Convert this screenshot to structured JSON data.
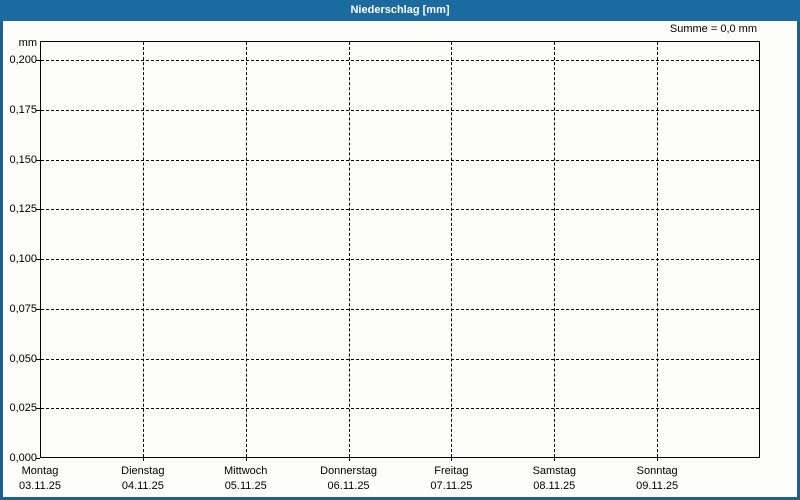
{
  "window": {
    "title": "Niederschlag [mm]"
  },
  "summary": {
    "text": "Summe = 0,0 mm"
  },
  "chart_data": {
    "type": "bar",
    "title": "Niederschlag [mm]",
    "ylabel": "mm",
    "unit": "mm",
    "ylim": [
      0.0,
      0.21
    ],
    "grid": "dashed",
    "legend": "none",
    "summary": "Summe = 0,0 mm",
    "y_ticks": [
      {
        "value": 0.0,
        "label": "0,000"
      },
      {
        "value": 0.025,
        "label": "0,025"
      },
      {
        "value": 0.05,
        "label": "0,050"
      },
      {
        "value": 0.075,
        "label": "0,075"
      },
      {
        "value": 0.1,
        "label": "0,100"
      },
      {
        "value": 0.125,
        "label": "0,125"
      },
      {
        "value": 0.15,
        "label": "0,150"
      },
      {
        "value": 0.175,
        "label": "0,175"
      },
      {
        "value": 0.2,
        "label": "0,200"
      }
    ],
    "categories": [
      {
        "day": "Montag",
        "date": "03.11.25"
      },
      {
        "day": "Dienstag",
        "date": "04.11.25"
      },
      {
        "day": "Mittwoch",
        "date": "05.11.25"
      },
      {
        "day": "Donnerstag",
        "date": "06.11.25"
      },
      {
        "day": "Freitag",
        "date": "07.11.25"
      },
      {
        "day": "Samstag",
        "date": "08.11.25"
      },
      {
        "day": "Sonntag",
        "date": "09.11.25"
      }
    ],
    "series": [
      {
        "name": "Niederschlag",
        "values": [
          0.0,
          0.0,
          0.0,
          0.0,
          0.0,
          0.0,
          0.0
        ]
      }
    ]
  },
  "colors": {
    "titlebar": "#1b6ba0",
    "title_text": "#ffffff",
    "frame_border": "#1f608e",
    "background": "#fdfdfb",
    "grid": "#000000",
    "text": "#000000"
  }
}
